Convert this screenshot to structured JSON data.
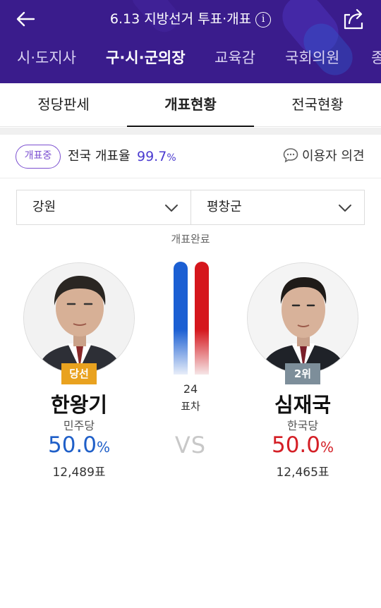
{
  "header": {
    "title": "6.13 지방선거 투표·개표",
    "info_icon": "info-icon",
    "back_icon": "arrow-left-icon",
    "share_icon": "share-icon",
    "background_color": "#3a1c8c"
  },
  "nav": {
    "items": [
      {
        "label": "시·도지사",
        "active": false
      },
      {
        "label": "구·시·군의장",
        "active": true
      },
      {
        "label": "교육감",
        "active": false
      },
      {
        "label": "국회의원",
        "active": false
      },
      {
        "label": "종",
        "active": false
      }
    ]
  },
  "subtabs": [
    {
      "label": "정당판세",
      "active": false
    },
    {
      "label": "개표현황",
      "active": true
    },
    {
      "label": "전국현황",
      "active": false
    }
  ],
  "status": {
    "badge": "개표중",
    "rate_label": "전국 개표율",
    "rate_value": "99.7",
    "rate_unit": "%",
    "opinion_label": "이용자 의견",
    "opinion_icon": "chat-bubble-icon"
  },
  "filters": {
    "region": "강원",
    "district": "평창군"
  },
  "count_status": "개표완료",
  "candidates": [
    {
      "badge": "당선",
      "name": "한왕기",
      "party": "민주당",
      "percent": "50.0",
      "percent_unit": "%",
      "votes": "12,489표",
      "color": "#1f5fc8"
    },
    {
      "badge": "2위",
      "name": "심재국",
      "party": "한국당",
      "percent": "50.0",
      "percent_unit": "%",
      "votes": "12,465표",
      "color": "#d41f26"
    }
  ],
  "comparison": {
    "margin": "24",
    "margin_label": "표차",
    "vs": "VS"
  }
}
